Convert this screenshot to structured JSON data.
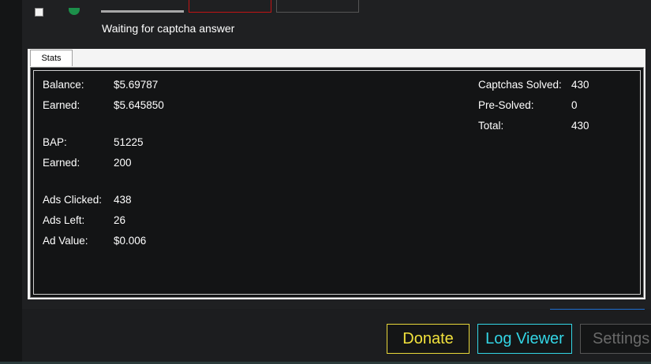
{
  "status": {
    "text": "Waiting for captcha answer"
  },
  "tabs": [
    {
      "label": "Stats"
    }
  ],
  "stats": {
    "left": [
      {
        "label": "Balance:",
        "value": "$5.69787"
      },
      {
        "label": "Earned:",
        "value": "$5.645850"
      },
      {
        "label": "BAP:",
        "value": "51225"
      },
      {
        "label": "Earned:",
        "value": "200"
      },
      {
        "label": "Ads Clicked:",
        "value": "438"
      },
      {
        "label": "Ads Left:",
        "value": "26"
      },
      {
        "label": "Ad Value:",
        "value": "$0.006"
      }
    ],
    "right": [
      {
        "label": "Captchas Solved:",
        "value": "430"
      },
      {
        "label": "Pre-Solved:",
        "value": "0"
      },
      {
        "label": "Total:",
        "value": "430"
      }
    ]
  },
  "buttons": {
    "donate": "Donate",
    "log_viewer": "Log Viewer",
    "settings": "Settings"
  },
  "colors": {
    "donate": "#f2e23c",
    "log_viewer": "#33d6e6",
    "settings_disabled": "#6a6a6a",
    "record": "#c21414"
  }
}
